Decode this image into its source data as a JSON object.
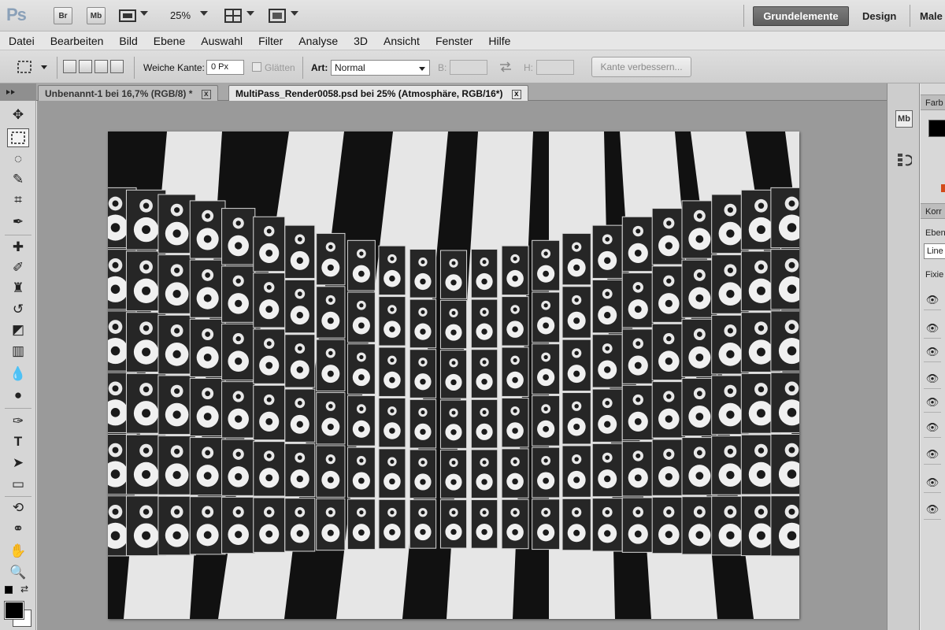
{
  "app": {
    "logo": "Ps",
    "launch_buttons": [
      "Br",
      "Mb"
    ],
    "zoom": "25%",
    "workspaces": [
      "Grundelemente",
      "Design",
      "Male"
    ]
  },
  "menu": [
    "Datei",
    "Bearbeiten",
    "Bild",
    "Ebene",
    "Auswahl",
    "Filter",
    "Analyse",
    "3D",
    "Ansicht",
    "Fenster",
    "Hilfe"
  ],
  "options": {
    "feather_label": "Weiche Kante:",
    "feather_value": "0 Px",
    "smooth_label": "Glätten",
    "style_label": "Art:",
    "style_value": "Normal",
    "width_label": "B:",
    "height_label": "H:",
    "refine_edge": "Kante verbessern..."
  },
  "tabs": [
    {
      "label": "Unbenannt-1 bei 16,7% (RGB/8) *",
      "close": "x"
    },
    {
      "label": "MultiPass_Render0058.psd bei 25% (Atmosphäre, RGB/16*)",
      "close": "x"
    }
  ],
  "panels": {
    "dock_icon": "Mb",
    "color_tab": "Farb",
    "corrections_tab": "Korr",
    "layers_tab": "Ebene",
    "blend_mode": "Line",
    "lock_label": "Fixie"
  },
  "colors": {
    "workspace_active_bg": "#6e6e6e",
    "canvas_bg": "#9a9a9a",
    "foreground": "#000000",
    "background": "#ffffff"
  }
}
